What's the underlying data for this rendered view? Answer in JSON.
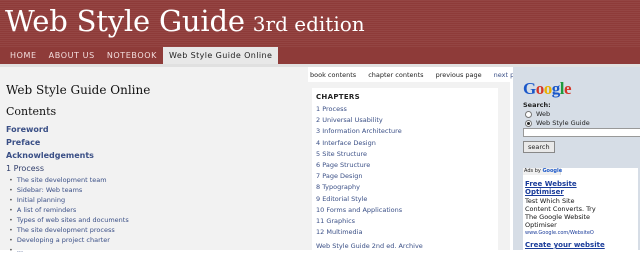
{
  "header": {
    "title": "Web Style Guide",
    "edition": "3rd edition"
  },
  "nav": {
    "tabs": [
      "HOME",
      "ABOUT US",
      "NOTEBOOK",
      "Web Style Guide Online"
    ]
  },
  "top_links": {
    "book_contents": "book contents",
    "chapter_contents": "chapter contents",
    "previous_page": "previous page",
    "next_page": "next page"
  },
  "left": {
    "title": "Web Style Guide Online",
    "contents_heading": "Contents",
    "major_links": [
      "Foreword",
      "Preface",
      "Acknowledgements"
    ],
    "chapter_heading": "1 Process",
    "sub_items": [
      "The site development team",
      "Sidebar: Web teams",
      "Initial planning",
      "A list of reminders",
      "Types of web sites and documents",
      "The site development process",
      "Developing a project charter",
      "..."
    ]
  },
  "chapters": {
    "heading": "CHAPTERS",
    "items": [
      "1 Process",
      "2 Universal Usability",
      "3 Information Architecture",
      "4 Interface Design",
      "5 Site Structure",
      "6 Page Structure",
      "7 Page Design",
      "8 Typography",
      "9 Editorial Style",
      "10 Forms and Applications",
      "11 Graphics",
      "12 Multimedia"
    ],
    "archive": "Web Style Guide 2nd ed. Archive"
  },
  "search": {
    "logo": "Google",
    "label": "Search:",
    "options": [
      "Web",
      "Web Style Guide"
    ],
    "selected": "Web Style Guide",
    "input_value": "",
    "button": "search"
  },
  "ad": {
    "badge_text": "Ads by",
    "badge_brand": "Google",
    "title": "Free Website",
    "title2": "Optimiser",
    "lines": [
      "Test Which Site",
      "Content Converts. Try",
      "The Google Website",
      "Optimiser"
    ],
    "url": "www.Google.com/WebsiteO",
    "title_b": "Create your website"
  }
}
